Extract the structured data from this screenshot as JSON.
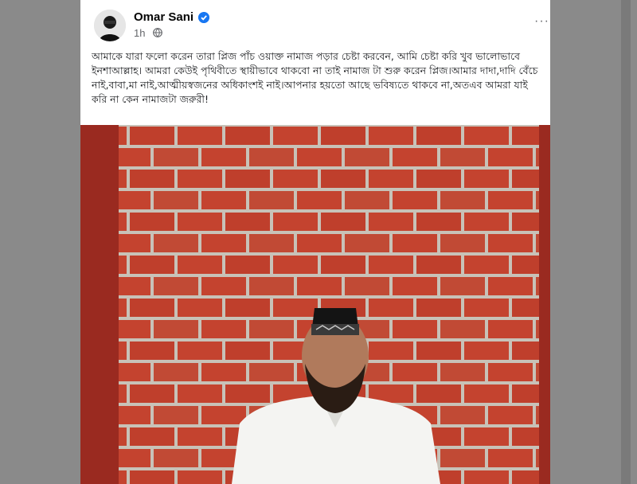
{
  "post": {
    "author": "Omar Sani",
    "time": "1h",
    "more_label": "···",
    "text": "আমাকে যারা ফলো করেন তারা প্লিজ পাঁচ ওয়াক্ত নামাজ পড়ার চেষ্টা করবেন, আমি চেষ্টা করি খুব ভালোভাবে ইনশাআল্লাহ।  আমরা কেউই পৃথিবীতে স্থায়ীভাবে থাকবো না তাই নামাজ টা শুরু করেন প্লিজ।আমার দাদা,দাদি বেঁচে নাই,বাবা,মা নাই,আত্মীয়স্বজনের অধিকাংশই নাই।আপনার হয়তো আছে ভবিষ্যতে থাকবে না,অতএব আমরা যাই করি না কেন নামাজটা জরুরী!"
  },
  "icons": {
    "avatar": "avatar",
    "verified": "verified-badge-icon",
    "globe": "globe-icon",
    "more": "more-options-icon"
  },
  "colors": {
    "page_background": "#8a8a8a",
    "card_background": "#ffffff",
    "verified_blue": "#1877f2",
    "photo_frame": "#9a2a20",
    "brick": "#c4432f",
    "mortar": "#c8c2b8"
  }
}
